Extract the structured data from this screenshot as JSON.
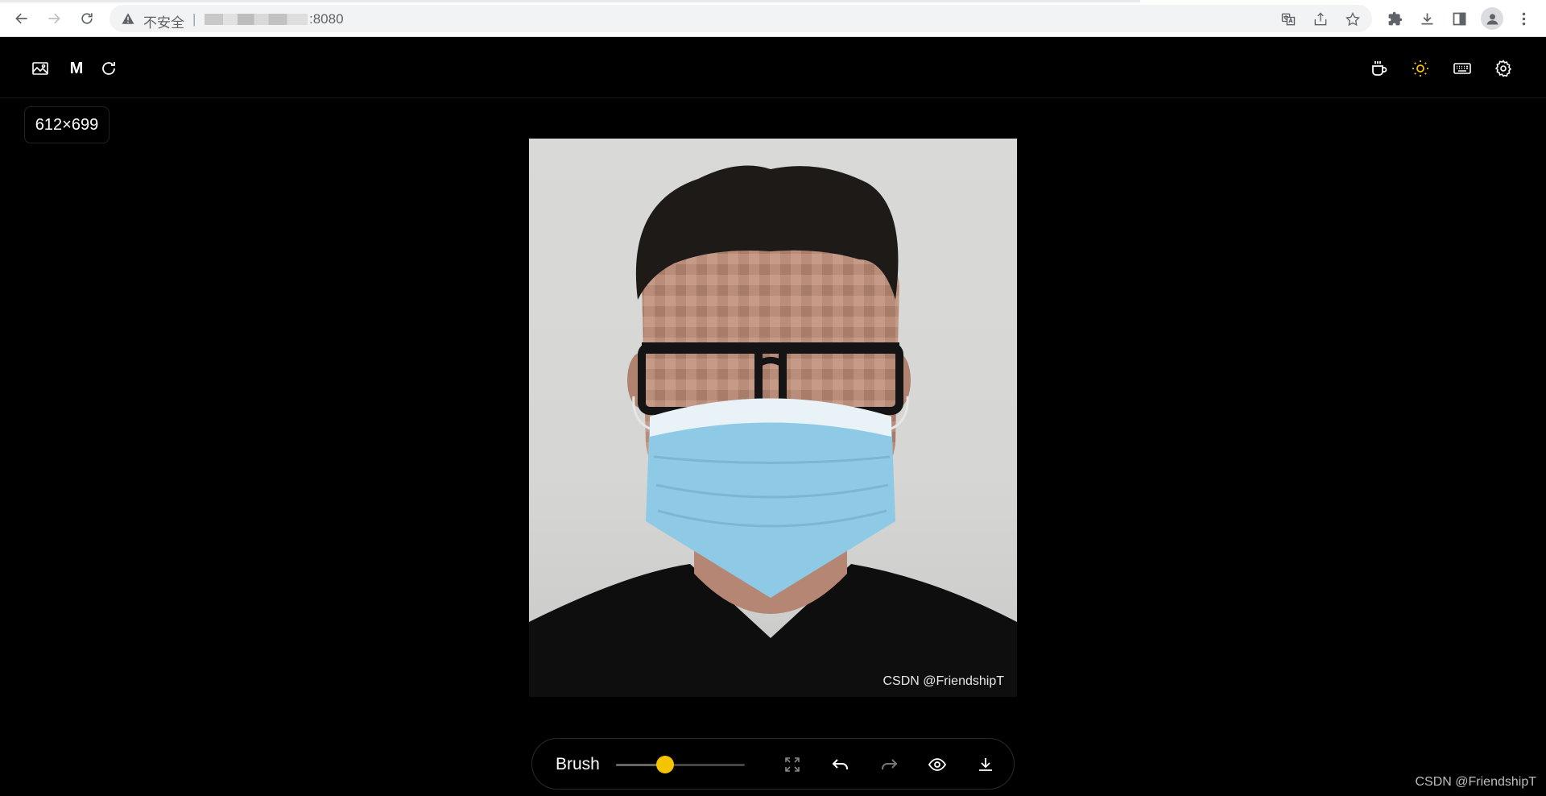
{
  "browser": {
    "security_label": "不安全",
    "separator": "|",
    "url_suffix": ":8080"
  },
  "app": {
    "header": {
      "mode_label": "M"
    },
    "image_size": "612×699",
    "photo": {
      "watermark": "CSDN @FriendshipT"
    },
    "toolbar": {
      "brush_label": "Brush",
      "brush_size_fraction": 0.38
    }
  },
  "page_watermark": "CSDN @FriendshipT",
  "colors": {
    "accent": "#f5c400",
    "background": "#000000"
  },
  "icons": {
    "header_left": [
      "image-icon",
      "refresh-icon"
    ],
    "header_right": [
      "coffee-icon",
      "sun-icon",
      "keyboard-icon",
      "settings-icon"
    ],
    "toolbar": [
      "fullscreen-icon",
      "undo-icon",
      "redo-icon",
      "eye-icon",
      "download-icon"
    ]
  }
}
